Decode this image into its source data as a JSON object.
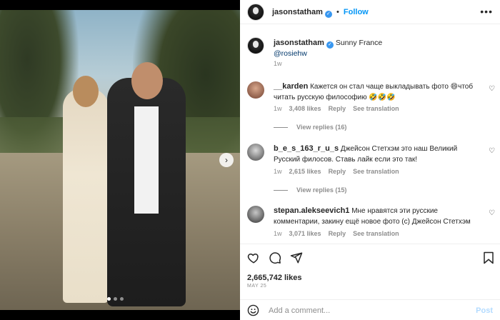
{
  "post": {
    "author": "jasonstatham",
    "follow_label": "Follow",
    "more_icon": "more-horizontal-icon"
  },
  "caption": {
    "author": "jasonstatham",
    "location": "Sunny France",
    "mention": "@rosiehw",
    "time": "1w"
  },
  "comments": [
    {
      "username": "__karden",
      "text": "Кажется он стал чаще выкладывать фото 😄чтоб читать русскую философию 🤣🤣🤣",
      "time": "1w",
      "likes": "3,408 likes",
      "reply": "Reply",
      "see_translation": "See translation",
      "view_replies": "View replies (16)"
    },
    {
      "username": "b_e_s_163_r_u_s",
      "text": "Джейсон Стетхэм это наш Великий Русский филосов. Ставь лайк если это так!",
      "time": "1w",
      "likes": "2,615 likes",
      "reply": "Reply",
      "see_translation": "See translation",
      "view_replies": "View replies (15)"
    },
    {
      "username": "stepan.alekseevich1",
      "text": "Мне нравятся эти русские комментарии, закину ещё новое фото (с) Джейсон Стетхэм",
      "time": "1w",
      "likes": "3,071 likes",
      "reply": "Reply",
      "see_translation": "See translation"
    }
  ],
  "actions": {
    "likes": "2,665,742 likes",
    "date": "MAY 25"
  },
  "composer": {
    "placeholder": "Add a comment...",
    "post_label": "Post"
  },
  "carousel": {
    "current_index": 1,
    "count": 3
  },
  "colors": {
    "accent": "#0095f6",
    "verified": "#3897f0",
    "muted": "#8e8e8e",
    "text": "#262626"
  }
}
